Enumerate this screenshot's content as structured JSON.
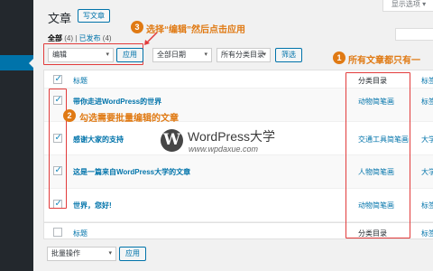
{
  "header": {
    "title": "文章",
    "add_new": "写文章",
    "screen_options": "显示选项"
  },
  "views": {
    "all_label": "全部",
    "all_count": "(4)",
    "sep": "|",
    "published_label": "已发布",
    "published_count": "(4)"
  },
  "filters": {
    "bulk_action_selected": "编辑",
    "apply": "应用",
    "date_selected": "全部日期",
    "category_selected": "所有分类目录",
    "filter_button": "筛选"
  },
  "table": {
    "columns": {
      "title": "标题",
      "category": "分类目录",
      "tags": "标签"
    },
    "rows": [
      {
        "title": "带你走进WordPress的世界",
        "category": "动物简笔画",
        "tags": "标签",
        "checked": true
      },
      {
        "title": "感谢大家的支持",
        "category": "交通工具简笔画",
        "tags": "大学",
        "checked": true
      },
      {
        "title": "这是一篇来自WordPress大学的文章",
        "category": "人物简笔画",
        "tags": "大学",
        "checked": true
      },
      {
        "title": "世界，您好!",
        "category": "动物简笔画",
        "tags": "标签",
        "checked": true
      }
    ],
    "footer": {
      "title": "标题",
      "category": "分类目录",
      "tags": "标签"
    }
  },
  "bottom": {
    "bulk_action_selected": "批量操作",
    "apply": "应用"
  },
  "annotations": {
    "step1_num": "1",
    "step1_text": "所有文章都只有一",
    "step2_num": "2",
    "step2_text": "勾选需要批量编辑的文章",
    "step3_num": "3",
    "step3_text": "选择“编辑”然后点击应用"
  },
  "watermark": {
    "name": "WordPress大学",
    "url": "www.wpdaxue.com"
  },
  "colors": {
    "sidebar": "#23282d",
    "accent": "#0073aa",
    "callout": "#e07a14",
    "highlight": "#e23b3b"
  }
}
